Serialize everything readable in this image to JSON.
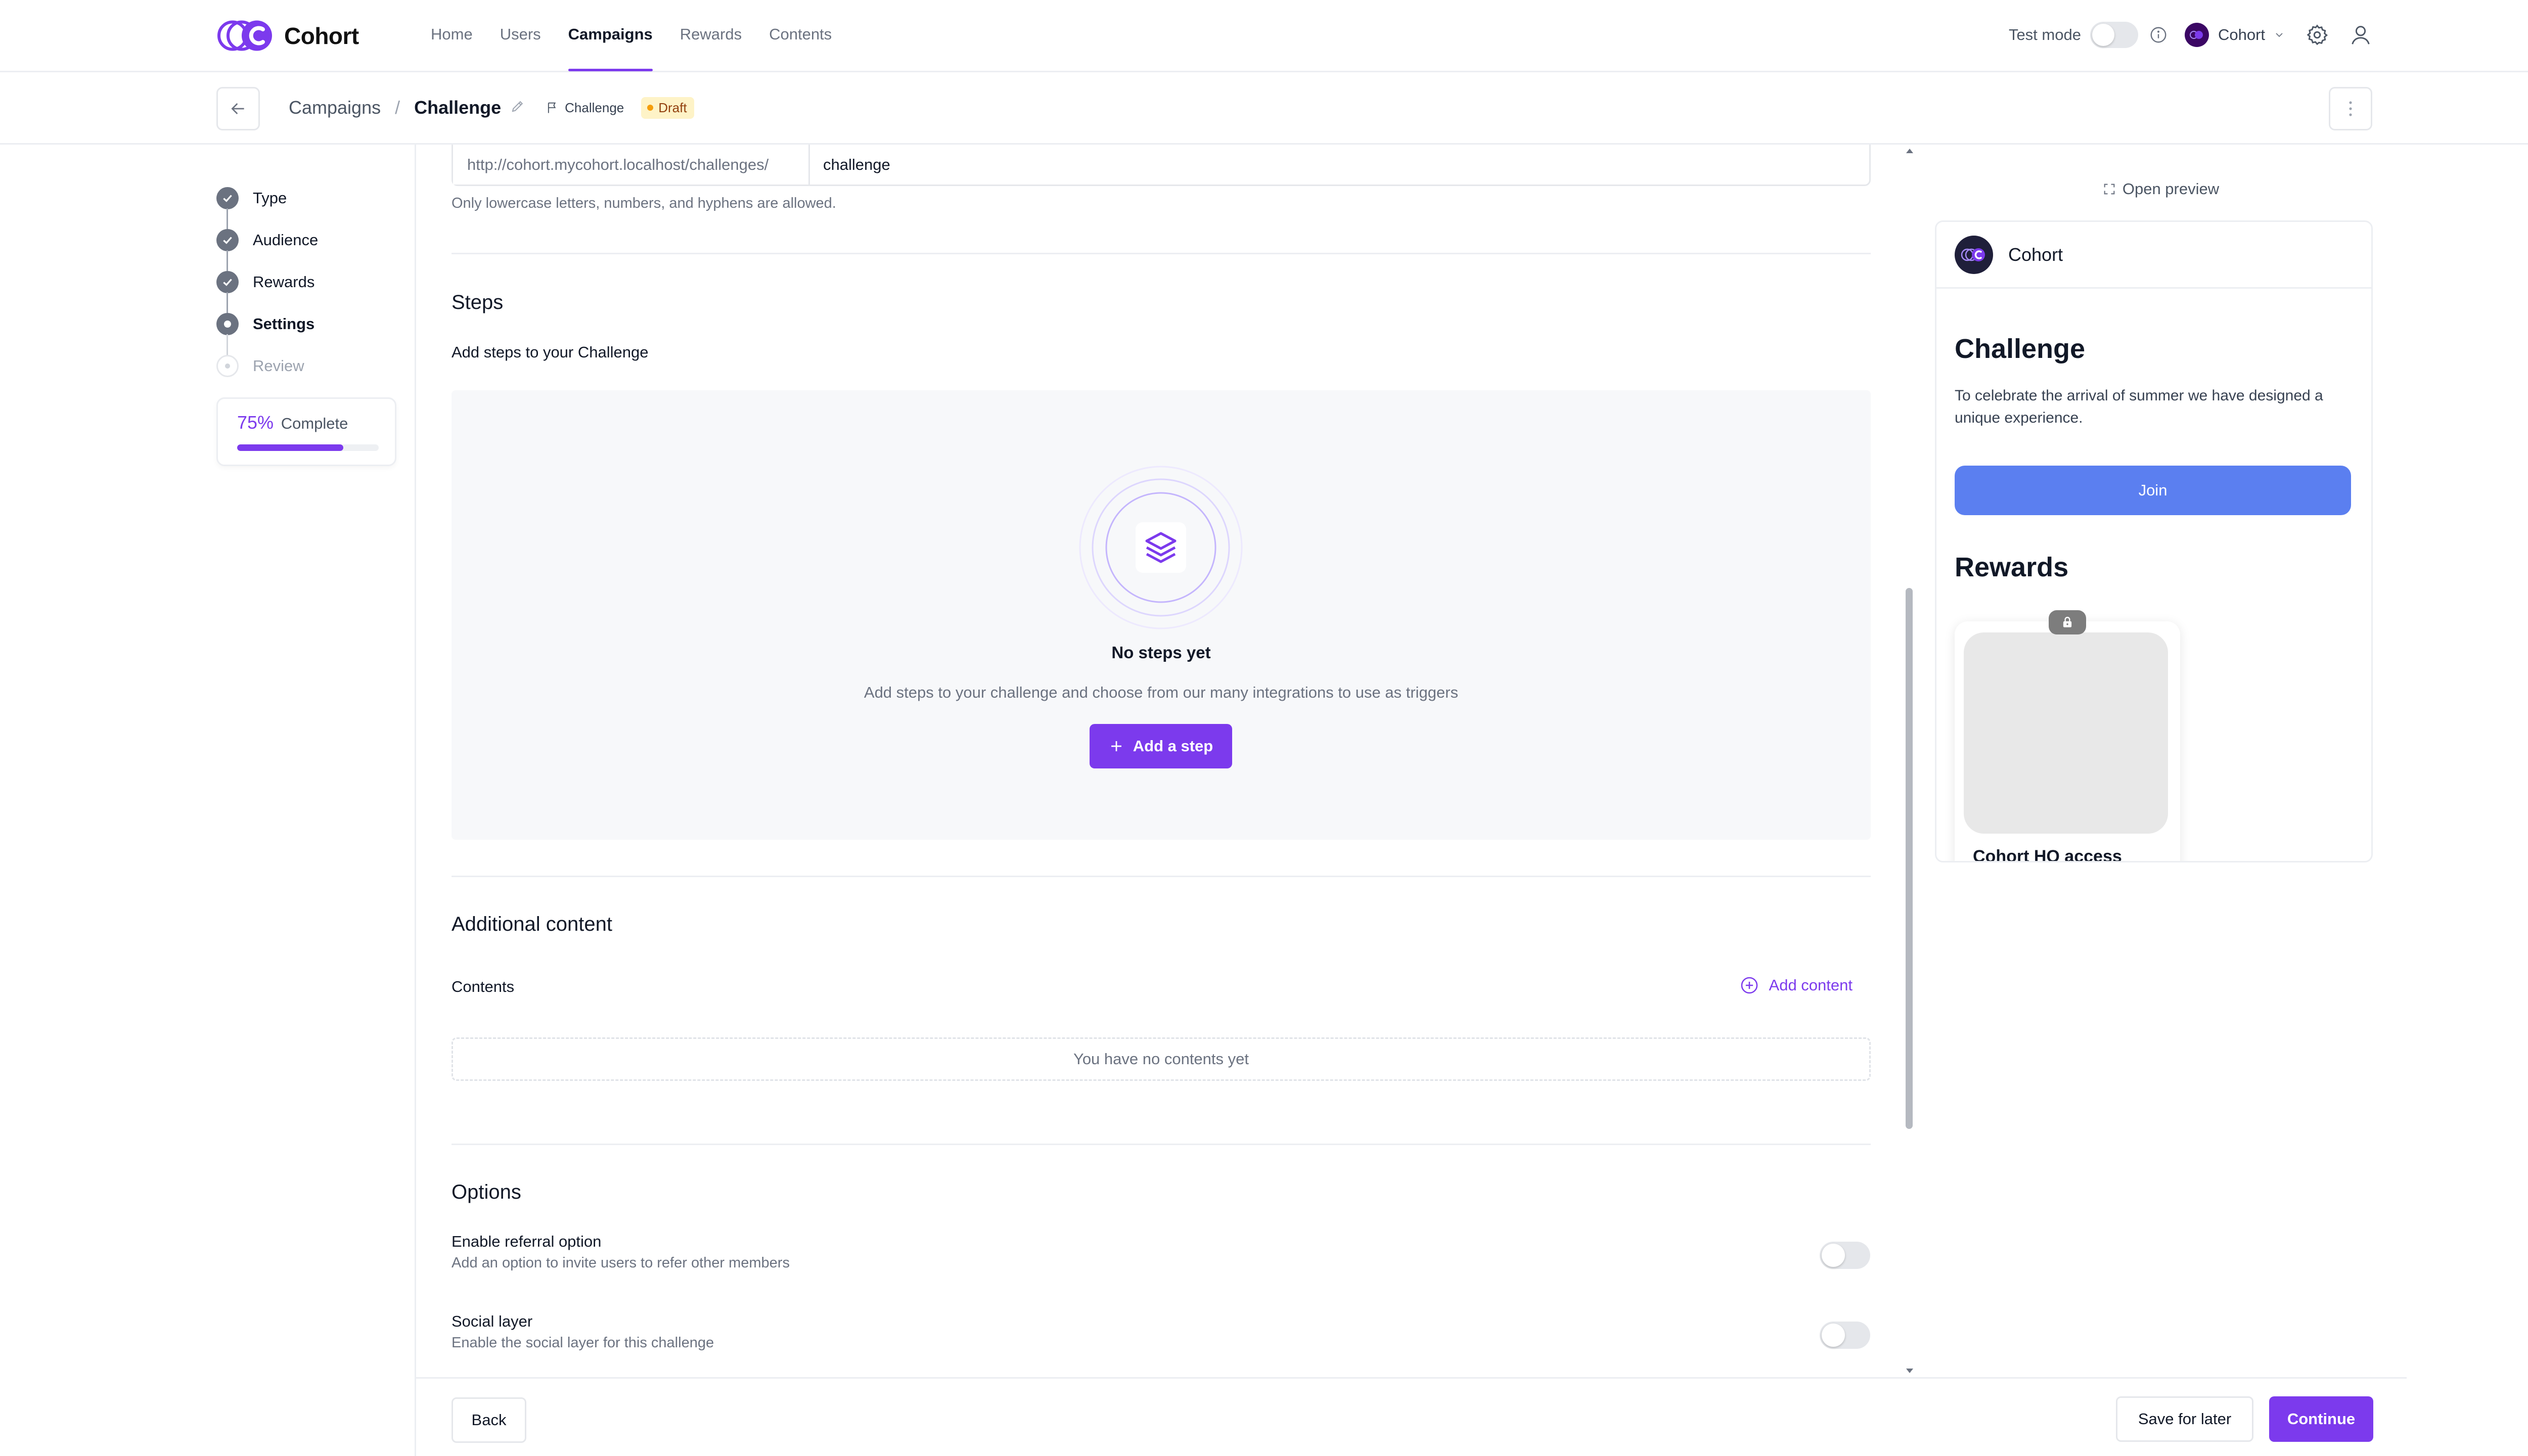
{
  "brand": {
    "name": "Cohort",
    "accent": "#7c3aed"
  },
  "nav": {
    "links": [
      "Home",
      "Users",
      "Campaigns",
      "Rewards",
      "Contents"
    ],
    "active": "Campaigns"
  },
  "topbar": {
    "test_mode_label": "Test mode",
    "test_mode_on": false,
    "org_name": "Cohort"
  },
  "subheader": {
    "breadcrumb_parent": "Campaigns",
    "breadcrumb_sep": "/",
    "breadcrumb_current": "Challenge",
    "type_badge": "Challenge",
    "status_badge": "Draft"
  },
  "wizard": {
    "steps": [
      {
        "label": "Type",
        "state": "done"
      },
      {
        "label": "Audience",
        "state": "done"
      },
      {
        "label": "Rewards",
        "state": "done"
      },
      {
        "label": "Settings",
        "state": "current"
      },
      {
        "label": "Review",
        "state": "todo"
      }
    ],
    "progress_pct": "75%",
    "progress_label": "Complete",
    "progress_value": 0.75
  },
  "settings": {
    "url_prefix": "http://cohort.mycohort.localhost/challenges/",
    "url_slug": "challenge",
    "url_help": "Only lowercase letters, numbers, and hyphens are allowed.",
    "steps_title": "Steps",
    "steps_subtitle": "Add steps to your Challenge",
    "empty_title": "No steps yet",
    "empty_desc": "Add steps to your challenge and choose from our many integrations to use as triggers",
    "add_step_label": "Add a step",
    "additional_title": "Additional content",
    "contents_label": "Contents",
    "add_content_label": "Add content",
    "no_contents": "You have no contents yet",
    "options_title": "Options",
    "options": [
      {
        "title": "Enable referral option",
        "desc": "Add an option to invite users to refer other members",
        "enabled": false
      },
      {
        "title": "Social layer",
        "desc": "Enable the social layer for this challenge",
        "enabled": false
      }
    ]
  },
  "footer": {
    "back": "Back",
    "save": "Save for later",
    "continue": "Continue"
  },
  "preview": {
    "open_label": "Open preview",
    "org_name": "Cohort",
    "title": "Challenge",
    "description": "To celebrate the arrival of summer we have designed a unique experience.",
    "join_label": "Join",
    "rewards_title": "Rewards",
    "reward_name": "Cohort HQ access",
    "join_color": "#5b7ff0"
  }
}
